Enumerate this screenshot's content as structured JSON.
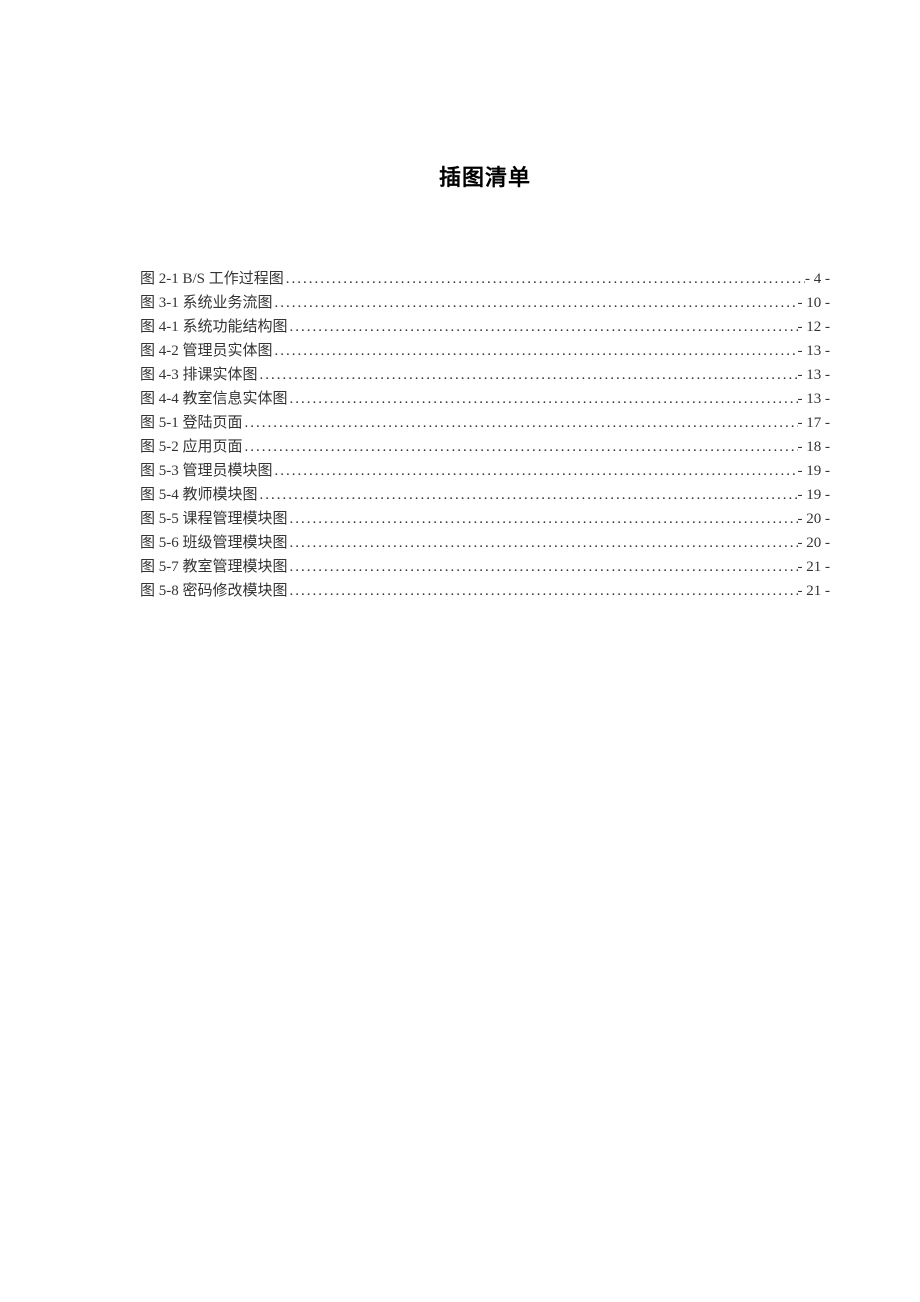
{
  "title": "插图清单",
  "entries": [
    {
      "label": "图 2-1 B/S 工作过程图",
      "page": "- 4 -"
    },
    {
      "label": "图 3-1 系统业务流图",
      "page": "- 10 -"
    },
    {
      "label": "图 4-1 系统功能结构图",
      "page": "- 12 -"
    },
    {
      "label": "图 4-2 管理员实体图",
      "page": "- 13 -"
    },
    {
      "label": "图 4-3 排课实体图",
      "page": "- 13 -"
    },
    {
      "label": "图 4-4 教室信息实体图",
      "page": "- 13 -"
    },
    {
      "label": "图 5-1 登陆页面",
      "page": "- 17 -"
    },
    {
      "label": "图 5-2 应用页面",
      "page": "- 18 -"
    },
    {
      "label": "图 5-3 管理员模块图",
      "page": "- 19 -"
    },
    {
      "label": "图 5-4 教师模块图",
      "page": "- 19 -"
    },
    {
      "label": "图 5-5 课程管理模块图",
      "page": "- 20 -"
    },
    {
      "label": "图 5-6 班级管理模块图",
      "page": "- 20 -"
    },
    {
      "label": "图 5-7 教室管理模块图",
      "page": "- 21 -"
    },
    {
      "label": "图 5-8 密码修改模块图",
      "page": "- 21 -"
    }
  ]
}
